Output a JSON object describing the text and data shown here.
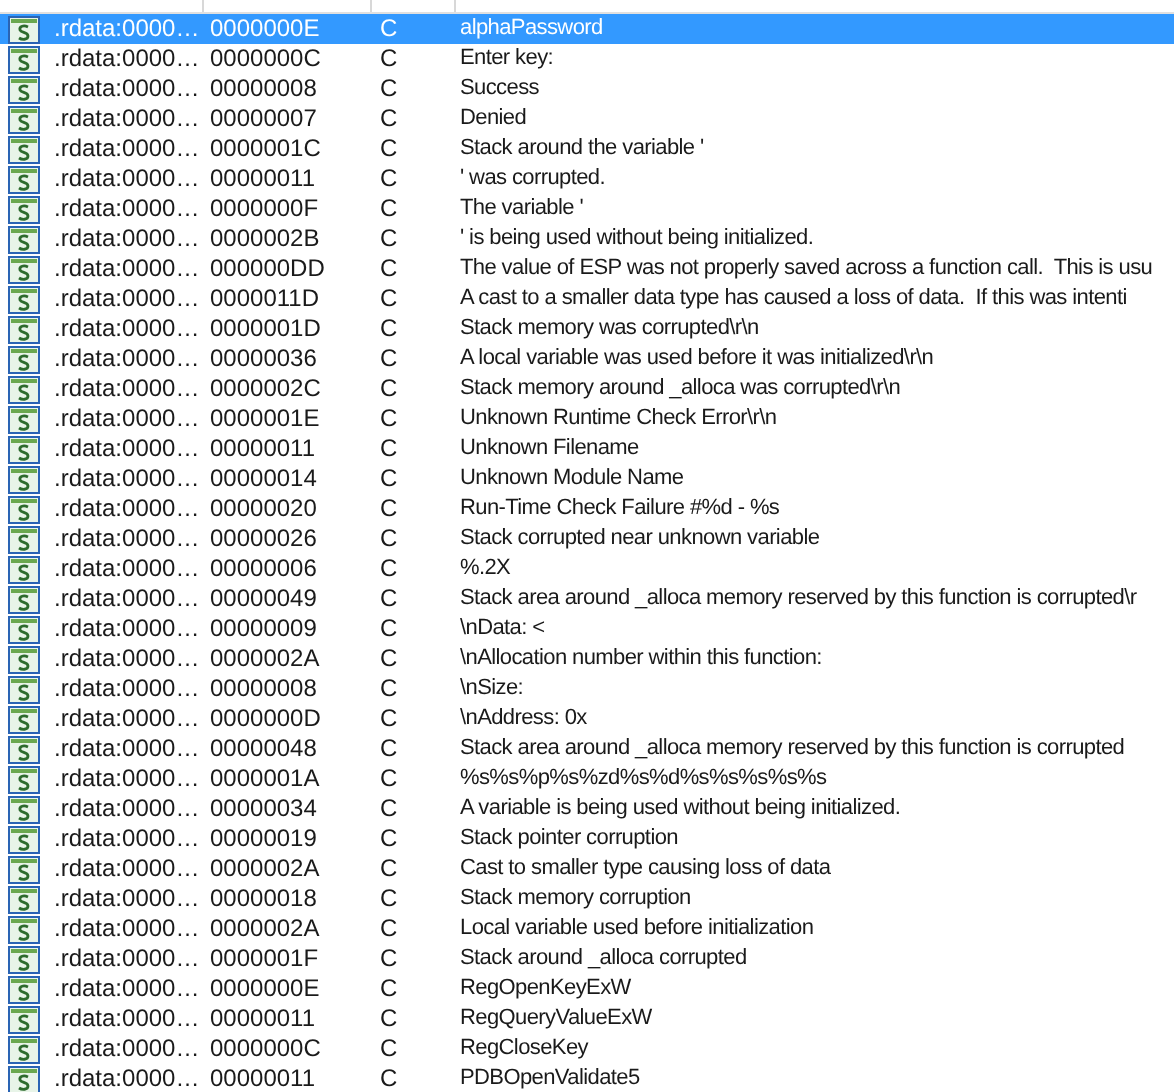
{
  "table": {
    "rows": [
      {
        "address": ".rdata:0000…",
        "length": "0000000E",
        "type": "C",
        "string": "alphaPassword",
        "selected": true
      },
      {
        "address": ".rdata:0000…",
        "length": "0000000C",
        "type": "C",
        "string": "Enter key:",
        "selected": false
      },
      {
        "address": ".rdata:0000…",
        "length": "00000008",
        "type": "C",
        "string": "Success",
        "selected": false
      },
      {
        "address": ".rdata:0000…",
        "length": "00000007",
        "type": "C",
        "string": "Denied",
        "selected": false
      },
      {
        "address": ".rdata:0000…",
        "length": "0000001C",
        "type": "C",
        "string": "Stack around the variable '",
        "selected": false
      },
      {
        "address": ".rdata:0000…",
        "length": "00000011",
        "type": "C",
        "string": "' was corrupted.",
        "selected": false
      },
      {
        "address": ".rdata:0000…",
        "length": "0000000F",
        "type": "C",
        "string": "The variable '",
        "selected": false
      },
      {
        "address": ".rdata:0000…",
        "length": "0000002B",
        "type": "C",
        "string": "' is being used without being initialized.",
        "selected": false
      },
      {
        "address": ".rdata:0000…",
        "length": "000000DD",
        "type": "C",
        "string": "The value of ESP was not properly saved across a function call.  This is usu",
        "selected": false
      },
      {
        "address": ".rdata:0000…",
        "length": "0000011D",
        "type": "C",
        "string": "A cast to a smaller data type has caused a loss of data.  If this was intenti",
        "selected": false
      },
      {
        "address": ".rdata:0000…",
        "length": "0000001D",
        "type": "C",
        "string": "Stack memory was corrupted\\r\\n",
        "selected": false
      },
      {
        "address": ".rdata:0000…",
        "length": "00000036",
        "type": "C",
        "string": "A local variable was used before it was initialized\\r\\n",
        "selected": false
      },
      {
        "address": ".rdata:0000…",
        "length": "0000002C",
        "type": "C",
        "string": "Stack memory around _alloca was corrupted\\r\\n",
        "selected": false
      },
      {
        "address": ".rdata:0000…",
        "length": "0000001E",
        "type": "C",
        "string": "Unknown Runtime Check Error\\r\\n",
        "selected": false
      },
      {
        "address": ".rdata:0000…",
        "length": "00000011",
        "type": "C",
        "string": "Unknown Filename",
        "selected": false
      },
      {
        "address": ".rdata:0000…",
        "length": "00000014",
        "type": "C",
        "string": "Unknown Module Name",
        "selected": false
      },
      {
        "address": ".rdata:0000…",
        "length": "00000020",
        "type": "C",
        "string": "Run-Time Check Failure #%d - %s",
        "selected": false
      },
      {
        "address": ".rdata:0000…",
        "length": "00000026",
        "type": "C",
        "string": "Stack corrupted near unknown variable",
        "selected": false
      },
      {
        "address": ".rdata:0000…",
        "length": "00000006",
        "type": "C",
        "string": "%.2X",
        "selected": false
      },
      {
        "address": ".rdata:0000…",
        "length": "00000049",
        "type": "C",
        "string": "Stack area around _alloca memory reserved by this function is corrupted\\r",
        "selected": false
      },
      {
        "address": ".rdata:0000…",
        "length": "00000009",
        "type": "C",
        "string": "\\nData: <",
        "selected": false
      },
      {
        "address": ".rdata:0000…",
        "length": "0000002A",
        "type": "C",
        "string": "\\nAllocation number within this function:",
        "selected": false
      },
      {
        "address": ".rdata:0000…",
        "length": "00000008",
        "type": "C",
        "string": "\\nSize:",
        "selected": false
      },
      {
        "address": ".rdata:0000…",
        "length": "0000000D",
        "type": "C",
        "string": "\\nAddress: 0x",
        "selected": false
      },
      {
        "address": ".rdata:0000…",
        "length": "00000048",
        "type": "C",
        "string": "Stack area around _alloca memory reserved by this function is corrupted",
        "selected": false
      },
      {
        "address": ".rdata:0000…",
        "length": "0000001A",
        "type": "C",
        "string": "%s%s%p%s%zd%s%d%s%s%s%s%s",
        "selected": false
      },
      {
        "address": ".rdata:0000…",
        "length": "00000034",
        "type": "C",
        "string": "A variable is being used without being initialized.",
        "selected": false
      },
      {
        "address": ".rdata:0000…",
        "length": "00000019",
        "type": "C",
        "string": "Stack pointer corruption",
        "selected": false
      },
      {
        "address": ".rdata:0000…",
        "length": "0000002A",
        "type": "C",
        "string": "Cast to smaller type causing loss of data",
        "selected": false
      },
      {
        "address": ".rdata:0000…",
        "length": "00000018",
        "type": "C",
        "string": "Stack memory corruption",
        "selected": false
      },
      {
        "address": ".rdata:0000…",
        "length": "0000002A",
        "type": "C",
        "string": "Local variable used before initialization",
        "selected": false
      },
      {
        "address": ".rdata:0000…",
        "length": "0000001F",
        "type": "C",
        "string": "Stack around _alloca corrupted",
        "selected": false
      },
      {
        "address": ".rdata:0000…",
        "length": "0000000E",
        "type": "C",
        "string": "RegOpenKeyExW",
        "selected": false
      },
      {
        "address": ".rdata:0000…",
        "length": "00000011",
        "type": "C",
        "string": "RegQueryValueExW",
        "selected": false
      },
      {
        "address": ".rdata:0000…",
        "length": "0000000C",
        "type": "C",
        "string": "RegCloseKey",
        "selected": false
      },
      {
        "address": ".rdata:0000…",
        "length": "00000011",
        "type": "C",
        "string": "PDBOpenValidate5",
        "selected": false
      }
    ]
  }
}
